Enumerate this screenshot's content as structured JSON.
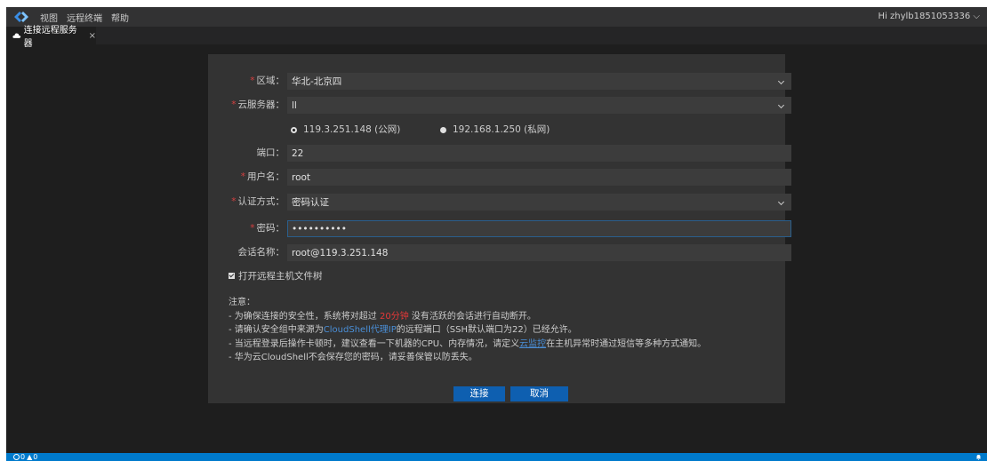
{
  "titlebar": {
    "menu": [
      "视图",
      "远程终端",
      "帮助"
    ],
    "user": "Hi zhylb1851053336 ⌵"
  },
  "tab": {
    "label": "连接远程服务器",
    "close": "×"
  },
  "form": {
    "region": {
      "label": "区域：",
      "value": "华北-北京四"
    },
    "server": {
      "label": "云服务器：",
      "value": "ll"
    },
    "ip_public": "119.3.251.148 (公网)",
    "ip_private": "192.168.1.250 (私网)",
    "port": {
      "label": "端口：",
      "value": "22"
    },
    "username": {
      "label": "用户名：",
      "value": "root"
    },
    "auth": {
      "label": "认证方式：",
      "value": "密码认证"
    },
    "password": {
      "label": "密码：",
      "value": "••••••••••"
    },
    "session": {
      "label": "会话名称：",
      "value": "root@119.3.251.148"
    },
    "open_tree": "打开远程主机文件树"
  },
  "notes": {
    "title": "注意：",
    "l1_a": "- 为确保连接的安全性，系统将对超过 ",
    "l1_b": "20分钟",
    "l1_c": " 没有活跃的会话进行自动断开。",
    "l2_a": "- 请确认安全组中来源为",
    "l2_b": "CloudShell代理IP",
    "l2_c": "的远程端口（SSH默认端口为22）已经允许。",
    "l3_a": "- 当远程登录后操作卡顿时，建议查看一下机器的CPU、内存情况，请定义",
    "l3_b": "云监控",
    "l3_c": "在主机异常时通过短信等多种方式通知。",
    "l4": "- 华为云CloudShell不会保存您的密码，请妥善保管以防丢失。"
  },
  "buttons": {
    "connect": "连接",
    "cancel": "取消"
  },
  "statusbar": {
    "errors": "0",
    "warnings": "0"
  }
}
